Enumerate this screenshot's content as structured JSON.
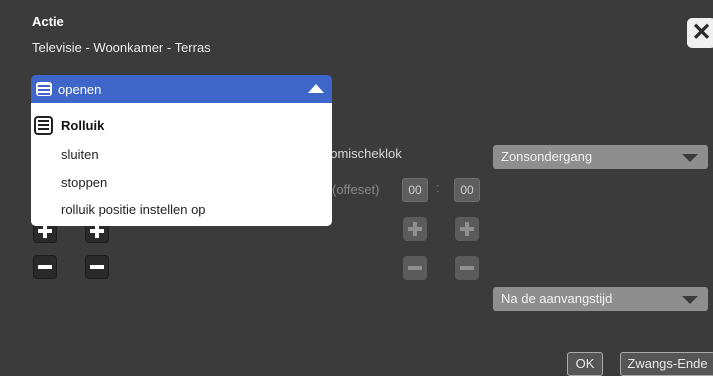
{
  "dialog": {
    "title": "Actie",
    "subtitle": "Televisie - Woonkamer - Terras",
    "close_glyph": "✕"
  },
  "dropdown": {
    "selected": "openen",
    "selected_icon": "roller-shutter-icon",
    "group_label": "Rolluik",
    "group_icon": "roller-shutter-icon",
    "options": [
      "sluiten",
      "stoppen",
      "rolluik positie instellen op"
    ],
    "highlight_color": "#3e66c8"
  },
  "astro": {
    "label": "nomischeklok",
    "offset_label": "(offeset)",
    "hours": "00",
    "separator": ":",
    "minutes": "00",
    "sun_select": "Zonsondergang"
  },
  "timing": {
    "after_select": "Na de aanvangstijd"
  },
  "footer": {
    "ok": "OK",
    "force_end": "Zwangs-Ende"
  }
}
